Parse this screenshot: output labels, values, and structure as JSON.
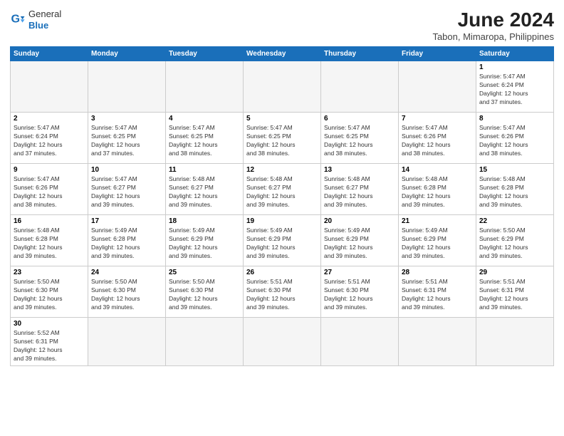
{
  "header": {
    "logo_general": "General",
    "logo_blue": "Blue",
    "month_title": "June 2024",
    "subtitle": "Tabon, Mimaropa, Philippines"
  },
  "days_of_week": [
    "Sunday",
    "Monday",
    "Tuesday",
    "Wednesday",
    "Thursday",
    "Friday",
    "Saturday"
  ],
  "weeks": [
    {
      "days": [
        {
          "num": "",
          "info": ""
        },
        {
          "num": "",
          "info": ""
        },
        {
          "num": "",
          "info": ""
        },
        {
          "num": "",
          "info": ""
        },
        {
          "num": "",
          "info": ""
        },
        {
          "num": "",
          "info": ""
        },
        {
          "num": "1",
          "info": "Sunrise: 5:47 AM\nSunset: 6:24 PM\nDaylight: 12 hours\nand 37 minutes."
        }
      ]
    },
    {
      "days": [
        {
          "num": "2",
          "info": "Sunrise: 5:47 AM\nSunset: 6:24 PM\nDaylight: 12 hours\nand 37 minutes."
        },
        {
          "num": "3",
          "info": "Sunrise: 5:47 AM\nSunset: 6:25 PM\nDaylight: 12 hours\nand 37 minutes."
        },
        {
          "num": "4",
          "info": "Sunrise: 5:47 AM\nSunset: 6:25 PM\nDaylight: 12 hours\nand 38 minutes."
        },
        {
          "num": "5",
          "info": "Sunrise: 5:47 AM\nSunset: 6:25 PM\nDaylight: 12 hours\nand 38 minutes."
        },
        {
          "num": "6",
          "info": "Sunrise: 5:47 AM\nSunset: 6:25 PM\nDaylight: 12 hours\nand 38 minutes."
        },
        {
          "num": "7",
          "info": "Sunrise: 5:47 AM\nSunset: 6:26 PM\nDaylight: 12 hours\nand 38 minutes."
        },
        {
          "num": "8",
          "info": "Sunrise: 5:47 AM\nSunset: 6:26 PM\nDaylight: 12 hours\nand 38 minutes."
        }
      ]
    },
    {
      "days": [
        {
          "num": "9",
          "info": "Sunrise: 5:47 AM\nSunset: 6:26 PM\nDaylight: 12 hours\nand 38 minutes."
        },
        {
          "num": "10",
          "info": "Sunrise: 5:47 AM\nSunset: 6:27 PM\nDaylight: 12 hours\nand 39 minutes."
        },
        {
          "num": "11",
          "info": "Sunrise: 5:48 AM\nSunset: 6:27 PM\nDaylight: 12 hours\nand 39 minutes."
        },
        {
          "num": "12",
          "info": "Sunrise: 5:48 AM\nSunset: 6:27 PM\nDaylight: 12 hours\nand 39 minutes."
        },
        {
          "num": "13",
          "info": "Sunrise: 5:48 AM\nSunset: 6:27 PM\nDaylight: 12 hours\nand 39 minutes."
        },
        {
          "num": "14",
          "info": "Sunrise: 5:48 AM\nSunset: 6:28 PM\nDaylight: 12 hours\nand 39 minutes."
        },
        {
          "num": "15",
          "info": "Sunrise: 5:48 AM\nSunset: 6:28 PM\nDaylight: 12 hours\nand 39 minutes."
        }
      ]
    },
    {
      "days": [
        {
          "num": "16",
          "info": "Sunrise: 5:48 AM\nSunset: 6:28 PM\nDaylight: 12 hours\nand 39 minutes."
        },
        {
          "num": "17",
          "info": "Sunrise: 5:49 AM\nSunset: 6:28 PM\nDaylight: 12 hours\nand 39 minutes."
        },
        {
          "num": "18",
          "info": "Sunrise: 5:49 AM\nSunset: 6:29 PM\nDaylight: 12 hours\nand 39 minutes."
        },
        {
          "num": "19",
          "info": "Sunrise: 5:49 AM\nSunset: 6:29 PM\nDaylight: 12 hours\nand 39 minutes."
        },
        {
          "num": "20",
          "info": "Sunrise: 5:49 AM\nSunset: 6:29 PM\nDaylight: 12 hours\nand 39 minutes."
        },
        {
          "num": "21",
          "info": "Sunrise: 5:49 AM\nSunset: 6:29 PM\nDaylight: 12 hours\nand 39 minutes."
        },
        {
          "num": "22",
          "info": "Sunrise: 5:50 AM\nSunset: 6:29 PM\nDaylight: 12 hours\nand 39 minutes."
        }
      ]
    },
    {
      "days": [
        {
          "num": "23",
          "info": "Sunrise: 5:50 AM\nSunset: 6:30 PM\nDaylight: 12 hours\nand 39 minutes."
        },
        {
          "num": "24",
          "info": "Sunrise: 5:50 AM\nSunset: 6:30 PM\nDaylight: 12 hours\nand 39 minutes."
        },
        {
          "num": "25",
          "info": "Sunrise: 5:50 AM\nSunset: 6:30 PM\nDaylight: 12 hours\nand 39 minutes."
        },
        {
          "num": "26",
          "info": "Sunrise: 5:51 AM\nSunset: 6:30 PM\nDaylight: 12 hours\nand 39 minutes."
        },
        {
          "num": "27",
          "info": "Sunrise: 5:51 AM\nSunset: 6:30 PM\nDaylight: 12 hours\nand 39 minutes."
        },
        {
          "num": "28",
          "info": "Sunrise: 5:51 AM\nSunset: 6:31 PM\nDaylight: 12 hours\nand 39 minutes."
        },
        {
          "num": "29",
          "info": "Sunrise: 5:51 AM\nSunset: 6:31 PM\nDaylight: 12 hours\nand 39 minutes."
        }
      ]
    },
    {
      "days": [
        {
          "num": "30",
          "info": "Sunrise: 5:52 AM\nSunset: 6:31 PM\nDaylight: 12 hours\nand 39 minutes."
        },
        {
          "num": "",
          "info": ""
        },
        {
          "num": "",
          "info": ""
        },
        {
          "num": "",
          "info": ""
        },
        {
          "num": "",
          "info": ""
        },
        {
          "num": "",
          "info": ""
        },
        {
          "num": "",
          "info": ""
        }
      ]
    }
  ]
}
